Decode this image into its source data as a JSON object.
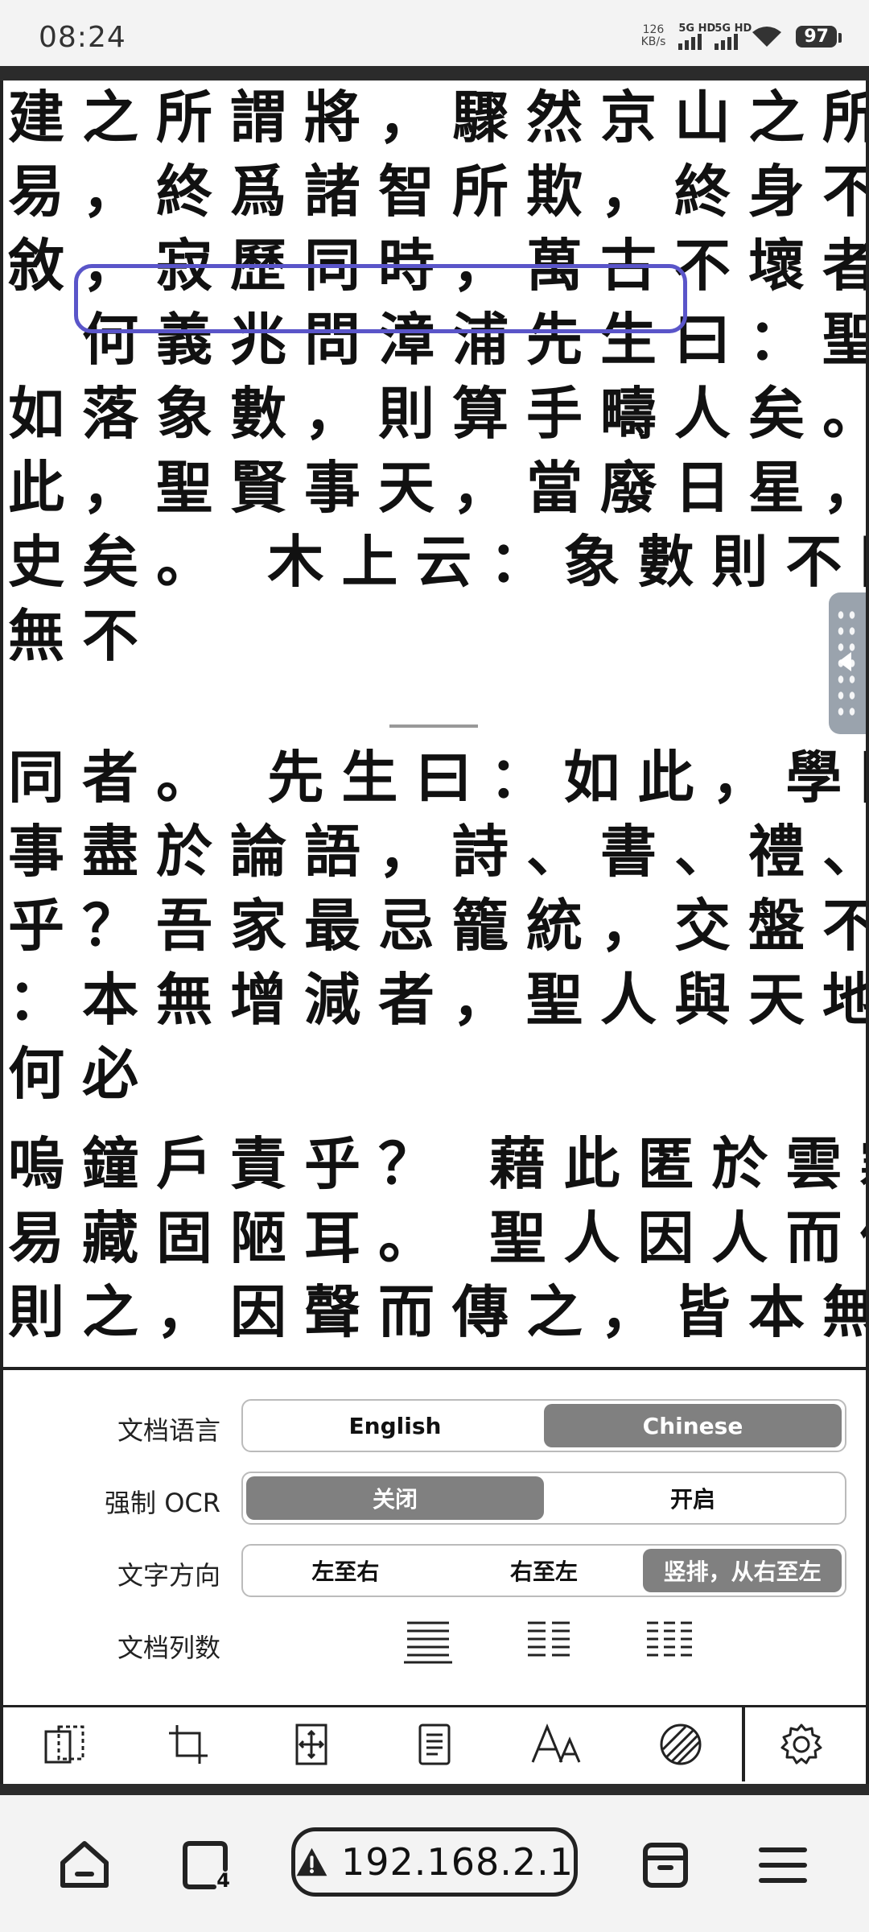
{
  "status_bar": {
    "time": "08:24",
    "net_speed_value": "126",
    "net_speed_unit": "KB/s",
    "signal1_label": "5G HD",
    "signal2_label": "5G HD",
    "battery": "97"
  },
  "document": {
    "lines": [
      "建之所謂將，驟然京山之所謂竊，不深於",
      "易，終爲諸智所欺，終身不反矣。 易之秩",
      "敘，寂歷同時，萬古不壞者也。",
      "　何義兆問漳浦先生曰：聖賢言理耳，",
      "如落象數，則算手疇人矣。先生曰：如",
      "此，聖賢事天，當廢日星，落日星亦臺官稗",
      "史矣。 木上云：象數則不同，何思何慮，",
      "無不",
      "同者。 先生曰：如此，學問止於中庸，行",
      "事盡於論語，詩、書、禮、樂、春秋何故作",
      "乎？吾家最忌籠統，交盤不得。 潛老夫曰",
      "：本無增減者，聖人與天地皆不憂者也。",
      "何必",
      "嗚鐘戶責乎？ 藉此匿於雲霧，又能奪人，",
      "易藏固陋耳。 聖人因人而倫之，因物而",
      "則之，因聲而傳之，皆本無增減者也，而能"
    ]
  },
  "settings": {
    "language": {
      "label": "文档语言",
      "options": [
        "English",
        "Chinese"
      ],
      "selected": "Chinese"
    },
    "force_ocr": {
      "label": "强制 OCR",
      "options": [
        "关闭",
        "开启"
      ],
      "selected": "关闭"
    },
    "text_direction": {
      "label": "文字方向",
      "options": [
        "左至右",
        "右至左",
        "竖排，从右至左"
      ],
      "selected": "竖排，从右至左"
    },
    "columns": {
      "label": "文档列数",
      "options_icons": [
        "one-column-icon",
        "two-column-icon",
        "three-column-icon"
      ],
      "selected": "one-column-icon"
    }
  },
  "toolbar": {
    "icons": [
      "page-fit-icon",
      "crop-icon",
      "expand-icon",
      "page-view-icon",
      "font-size-icon",
      "contrast-icon",
      "gear-icon"
    ],
    "selected": "gear-icon"
  },
  "browser": {
    "url": "192.168.2.1",
    "tabs_count": "4",
    "icons": [
      "home-icon",
      "tabs-icon",
      "warning-icon",
      "bookmark-box-icon",
      "menu-icon"
    ]
  }
}
